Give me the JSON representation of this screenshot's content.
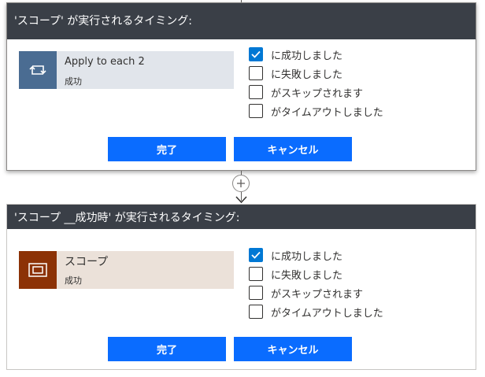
{
  "panels": [
    {
      "header": "'スコープ' が実行されるタイミング:",
      "action": {
        "name": "Apply to each 2",
        "status": "成功",
        "icon": "loop-icon"
      },
      "options": [
        {
          "label": "に成功しました",
          "checked": true
        },
        {
          "label": "に失敗しました",
          "checked": false
        },
        {
          "label": "がスキップされます",
          "checked": false
        },
        {
          "label": "がタイムアウトしました",
          "checked": false
        }
      ],
      "done_label": "完了",
      "cancel_label": "キャンセル"
    },
    {
      "header": "'スコープ __成功時' が実行されるタイミング:",
      "action": {
        "name": "スコープ",
        "status": "成功",
        "icon": "scope-icon"
      },
      "options": [
        {
          "label": "に成功しました",
          "checked": true
        },
        {
          "label": "に失敗しました",
          "checked": false
        },
        {
          "label": "がスキップされます",
          "checked": false
        },
        {
          "label": "がタイムアウトしました",
          "checked": false
        }
      ],
      "done_label": "完了",
      "cancel_label": "キャンセル"
    }
  ],
  "colors": {
    "header_bg": "#3a3f47",
    "primary_button": "#0a6cff",
    "checkbox_checked": "#0078d4",
    "loop_action": "#4a6c92",
    "scope_action": "#8c3206"
  }
}
